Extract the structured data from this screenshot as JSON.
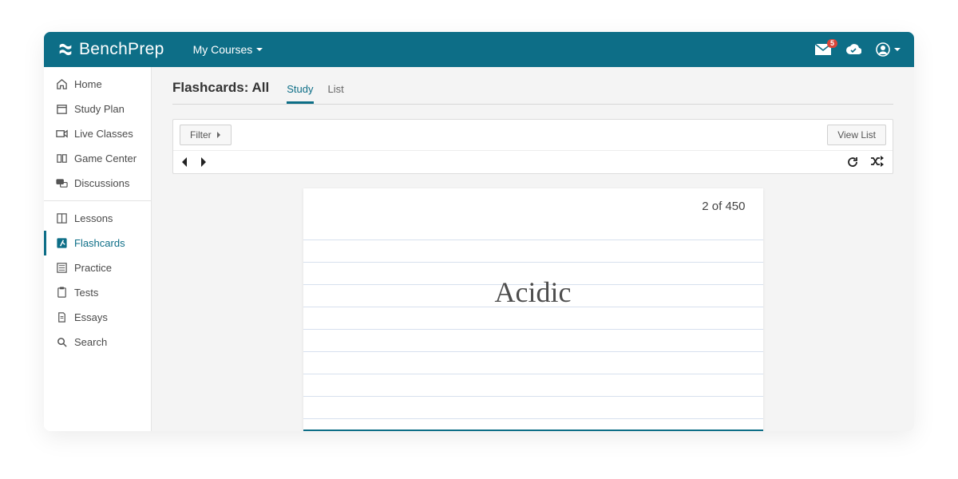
{
  "header": {
    "brand": "BenchPrep",
    "my_courses": "My Courses",
    "mail_badge": "5"
  },
  "sidebar": {
    "group1": [
      {
        "key": "home",
        "label": "Home"
      },
      {
        "key": "study-plan",
        "label": "Study Plan"
      },
      {
        "key": "live-classes",
        "label": "Live Classes"
      },
      {
        "key": "game-center",
        "label": "Game Center"
      },
      {
        "key": "discussions",
        "label": "Discussions"
      }
    ],
    "group2": [
      {
        "key": "lessons",
        "label": "Lessons"
      },
      {
        "key": "flashcards",
        "label": "Flashcards",
        "active": true
      },
      {
        "key": "practice",
        "label": "Practice"
      },
      {
        "key": "tests",
        "label": "Tests"
      },
      {
        "key": "essays",
        "label": "Essays"
      },
      {
        "key": "search",
        "label": "Search"
      }
    ]
  },
  "page": {
    "title": "Flashcards: All",
    "tabs": {
      "study": "Study",
      "list": "List"
    },
    "filter_label": "Filter",
    "view_list_label": "View List"
  },
  "card": {
    "counter": "2 of 450",
    "term": "Acidic"
  }
}
